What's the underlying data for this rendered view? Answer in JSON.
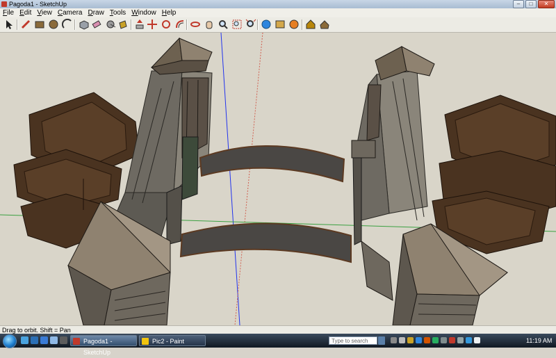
{
  "window": {
    "title": "Pagoda1 - SketchUp",
    "min_glyph": "–",
    "max_glyph": "□",
    "close_glyph": "✕"
  },
  "menubar": {
    "items": [
      "File",
      "Edit",
      "View",
      "Camera",
      "Draw",
      "Tools",
      "Window",
      "Help"
    ]
  },
  "toolbar": {
    "tools": [
      {
        "name": "select-tool-icon",
        "glyph": "arrow",
        "color": "#222222"
      },
      {
        "name": "line-tool-icon",
        "glyph": "pencil",
        "color": "#c0392b"
      },
      {
        "name": "rectangle-tool-icon",
        "glyph": "rect",
        "color": "#8a6a3a"
      },
      {
        "name": "circle-tool-icon",
        "glyph": "circle",
        "color": "#8a6a3a"
      },
      {
        "name": "arc-tool-icon",
        "glyph": "arc",
        "color": "#333333"
      },
      {
        "name": "make-component-tool-icon",
        "glyph": "box",
        "color": "#9aa0a8"
      },
      {
        "name": "eraser-tool-icon",
        "glyph": "eraser",
        "color": "#d98fb0"
      },
      {
        "name": "tape-measure-tool-icon",
        "glyph": "tape",
        "color": "#9a9a9a"
      },
      {
        "name": "paint-bucket-tool-icon",
        "glyph": "bucket",
        "color": "#c9a227"
      },
      {
        "name": "push-pull-tool-icon",
        "glyph": "pushpull",
        "color": "#c0392b"
      },
      {
        "name": "move-tool-icon",
        "glyph": "move",
        "color": "#c0392b"
      },
      {
        "name": "rotate-tool-icon",
        "glyph": "rotate",
        "color": "#c0392b"
      },
      {
        "name": "offset-tool-icon",
        "glyph": "offset",
        "color": "#c0392b"
      },
      {
        "name": "orbit-tool-icon",
        "glyph": "orbit",
        "color": "#c0392b"
      },
      {
        "name": "pan-tool-icon",
        "glyph": "hand",
        "color": "#e6c9a8"
      },
      {
        "name": "zoom-tool-icon",
        "glyph": "zoom",
        "color": "#333333"
      },
      {
        "name": "zoom-window-tool-icon",
        "glyph": "zoomwin",
        "color": "#333333"
      },
      {
        "name": "zoom-extents-tool-icon",
        "glyph": "zoomext",
        "color": "#333333"
      },
      {
        "name": "previous-view-icon",
        "glyph": "globe",
        "color": "#2e86de"
      },
      {
        "name": "next-view-icon",
        "glyph": "photo",
        "color": "#d4a84b"
      },
      {
        "name": "get-models-icon",
        "glyph": "share",
        "color": "#e67e22"
      },
      {
        "name": "share-model-icon",
        "glyph": "house",
        "color": "#b8860b"
      },
      {
        "name": "warehouse-icon",
        "glyph": "house2",
        "color": "#8b6b3a"
      }
    ]
  },
  "status": {
    "text": "Drag to orbit.  Shift = Pan"
  },
  "taskbar": {
    "start_label": "Start",
    "tasks": [
      {
        "label": "Pagoda1 - SketchUp",
        "active": true,
        "color": "#c0392b"
      },
      {
        "label": "Pic2 - Paint",
        "active": false,
        "color": "#f1c40f"
      }
    ],
    "search_placeholder": "Type to search",
    "clock": "11:19 AM"
  }
}
